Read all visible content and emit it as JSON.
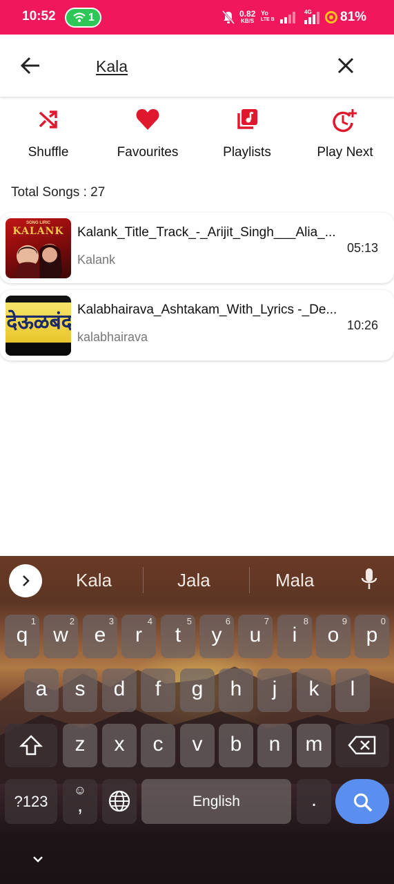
{
  "status_bar": {
    "time": "10:52",
    "hotspot_count": "1",
    "net_speed_value": "0.82",
    "net_speed_unit": "KB/S",
    "volte_top": "Yo",
    "volte_bottom": "LTE B",
    "network_type": "4G",
    "battery": "81%"
  },
  "search": {
    "query": "Kala"
  },
  "actions": [
    {
      "label": "Shuffle",
      "icon": "shuffle-icon"
    },
    {
      "label": "Favourites",
      "icon": "heart-icon"
    },
    {
      "label": "Playlists",
      "icon": "playlist-icon"
    },
    {
      "label": "Play Next",
      "icon": "play-next-icon"
    }
  ],
  "total_songs": "Total Songs : 27",
  "songs": [
    {
      "title": "Kalank_Title_Track_-_Arijit_Singh___Alia_...",
      "artist": "Kalank",
      "duration": "05:13",
      "thumb_text": "KALANK",
      "thumb_subtext": "SONG LIRIC"
    },
    {
      "title": "Kalabhairava_Ashtakam_With_Lyrics -_De...",
      "artist": "kalabhairava",
      "duration": "10:26",
      "thumb_text": "देऊळबंद"
    }
  ],
  "keyboard": {
    "suggestions": [
      "Kala",
      "Jala",
      "Mala"
    ],
    "row1": [
      {
        "key": "q",
        "hint": "1"
      },
      {
        "key": "w",
        "hint": "2"
      },
      {
        "key": "e",
        "hint": "3"
      },
      {
        "key": "r",
        "hint": "4"
      },
      {
        "key": "t",
        "hint": "5"
      },
      {
        "key": "y",
        "hint": "6"
      },
      {
        "key": "u",
        "hint": "7"
      },
      {
        "key": "i",
        "hint": "8"
      },
      {
        "key": "o",
        "hint": "9"
      },
      {
        "key": "p",
        "hint": "0"
      }
    ],
    "row2": [
      "a",
      "s",
      "d",
      "f",
      "g",
      "h",
      "j",
      "k",
      "l"
    ],
    "row3": [
      "z",
      "x",
      "c",
      "v",
      "b",
      "n",
      "m"
    ],
    "symbols_label": "?123",
    "comma_label": ",",
    "emoji_hint": "☺",
    "space_label": "English",
    "period_label": "."
  },
  "colors": {
    "brand": "#f0175a",
    "accent_red": "#e0182d",
    "hotspot_green": "#2ec657",
    "search_key_blue": "#5a8ff0"
  }
}
